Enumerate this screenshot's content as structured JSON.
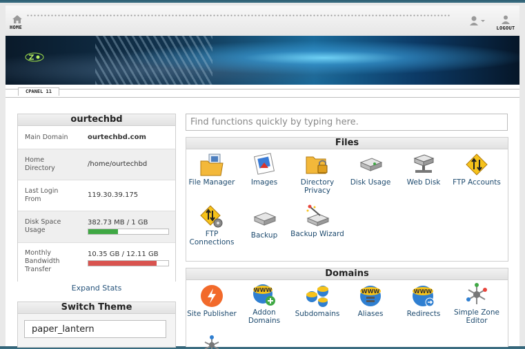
{
  "nav": {
    "home": "HOME",
    "logout": "LOGOUT",
    "version": "CPANEL 11"
  },
  "stats": {
    "title": "ourtechbd",
    "rows": [
      {
        "label": "Main Domain",
        "value": "ourtechbd.com",
        "bold": true
      },
      {
        "label": "Home Directory",
        "value": "/home/ourtechbd"
      },
      {
        "label": "Last Login From",
        "value": "119.30.39.175"
      },
      {
        "label": "Disk Space Usage",
        "value": "382.73 MB / 1 GB",
        "fraction": 0.374,
        "color": "#3fa844"
      },
      {
        "label": "Monthly Bandwidth Transfer",
        "value": "10.35 GB / 12.11 GB",
        "fraction": 0.855,
        "color": "#d9534f"
      }
    ],
    "expand": "Expand Stats"
  },
  "theme": {
    "title": "Switch Theme",
    "selected": "paper_lantern"
  },
  "search": {
    "placeholder": "Find functions quickly by typing here."
  },
  "files": {
    "title": "Files",
    "items": [
      {
        "label": "File Manager",
        "icon": "file-manager-icon"
      },
      {
        "label": "Images",
        "icon": "images-icon"
      },
      {
        "label": "Directory Privacy",
        "icon": "directory-privacy-icon"
      },
      {
        "label": "Disk Usage",
        "icon": "disk-usage-icon"
      },
      {
        "label": "Web Disk",
        "icon": "web-disk-icon"
      },
      {
        "label": "FTP Accounts",
        "icon": "ftp-accounts-icon"
      },
      {
        "label": "FTP Connections",
        "icon": "ftp-connections-icon"
      },
      {
        "label": "Backup",
        "icon": "backup-icon"
      },
      {
        "label": "Backup Wizard",
        "icon": "backup-wizard-icon"
      }
    ]
  },
  "domains": {
    "title": "Domains",
    "items": [
      {
        "label": "Site Publisher",
        "icon": "site-publisher-icon"
      },
      {
        "label": "Addon Domains",
        "icon": "addon-domains-icon"
      },
      {
        "label": "Subdomains",
        "icon": "subdomains-icon"
      },
      {
        "label": "Aliases",
        "icon": "aliases-icon"
      },
      {
        "label": "Redirects",
        "icon": "redirects-icon"
      },
      {
        "label": "Simple Zone Editor",
        "icon": "simple-zone-editor-icon"
      }
    ]
  }
}
